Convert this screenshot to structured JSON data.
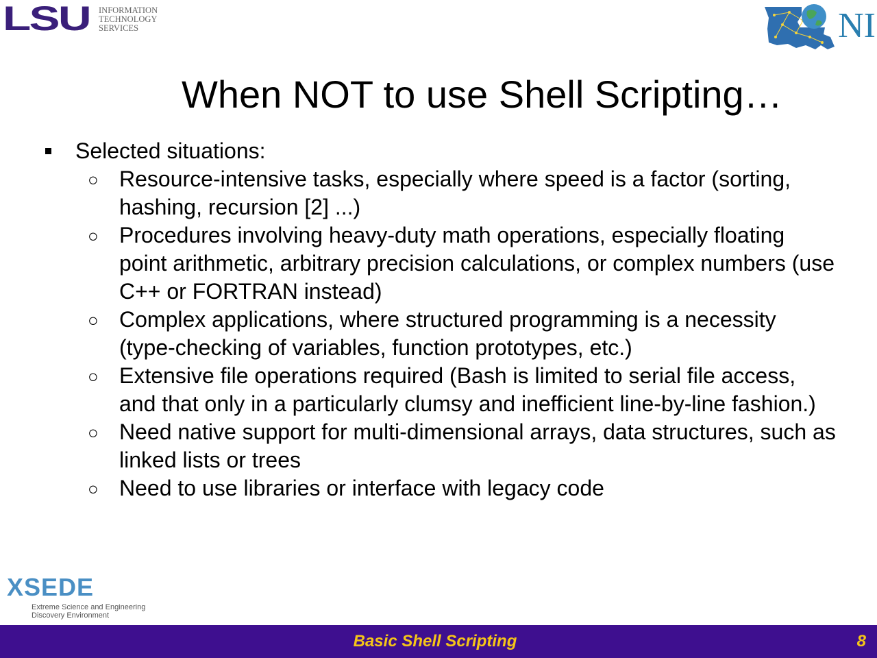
{
  "header": {
    "lsu_logo": {
      "letters": "LSU",
      "lines": [
        "INFORMATION",
        "TECHNOLOGY",
        "SERVICES"
      ]
    },
    "loni_logo": {
      "text": "NI"
    }
  },
  "title": {
    "before": "When ",
    "highlight": "NOT",
    "after": " to use Shell Scripting…"
  },
  "colors": {
    "title_highlight": "#1c1ccf",
    "footer_bg": "#3e0f8f",
    "footer_text": "#f5c518",
    "lsu_purple": "#3a1f7a",
    "xsede_blue": "#4a8fc4"
  },
  "bullets": {
    "level1": "Selected situations:",
    "items": [
      {
        "text": "Resource-intensive tasks, especially where speed is a factor (sorting, hashing, recursion [2] ...)"
      },
      {
        "text": "Procedures involving heavy-duty math operations, especially floating point arithmetic, arbitrary precision calculations, or complex numbers (use C++ or FORTRAN instead)"
      },
      {
        "text": "Complex applications, where structured programming is a necessity (type-checking of variables, function prototypes, etc.)"
      },
      {
        "text": "Extensive file operations required (Bash is limited to serial file access, and that only in a particularly clumsy and inefficient line-by-line fashion.)"
      },
      {
        "text": "Need native support for multi-dimensional arrays, data structures, such as linked lists or trees"
      },
      {
        "text": "Need to use libraries or interface with legacy code"
      }
    ]
  },
  "xsede_logo": {
    "word": "XSEDE",
    "tagline": [
      "Extreme Science and Engineering",
      "Discovery Environment"
    ]
  },
  "footer": {
    "title": "Basic Shell Scripting",
    "page": "8"
  }
}
